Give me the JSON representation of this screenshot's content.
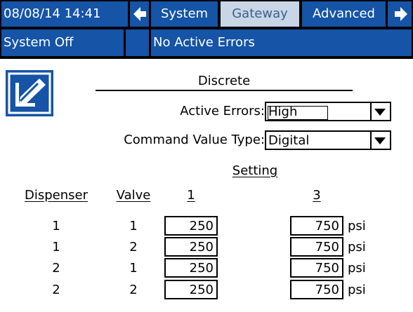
{
  "header": {
    "datetime": "08/08/14 14:41",
    "tabs": [
      {
        "label": "System",
        "active": false
      },
      {
        "label": "Gateway",
        "active": true
      },
      {
        "label": "Advanced",
        "active": false
      }
    ],
    "status": "System Off",
    "errors": "No Active Errors",
    "back_icon": "arrow-left-icon",
    "forward_icon": "arrow-right-icon"
  },
  "edit_icon": "edit-icon",
  "section_title": "Discrete",
  "fields": {
    "active_errors": {
      "label": "Active Errors:",
      "value": "High"
    },
    "command_value_type": {
      "label": "Command Value Type:",
      "value": "Digital"
    }
  },
  "table": {
    "setting_header": "Setting",
    "columns": [
      "Dispenser",
      "Valve",
      "1",
      "3"
    ],
    "unit": "psi",
    "rows": [
      {
        "dispenser": "1",
        "valve": "1",
        "s1": "250",
        "s3": "750"
      },
      {
        "dispenser": "1",
        "valve": "2",
        "s1": "250",
        "s3": "750"
      },
      {
        "dispenser": "2",
        "valve": "1",
        "s1": "250",
        "s3": "750"
      },
      {
        "dispenser": "2",
        "valve": "2",
        "s1": "250",
        "s3": "750"
      }
    ]
  },
  "colors": {
    "bar_blue": "#1554a6",
    "active_tab": "#c9d6e6"
  }
}
